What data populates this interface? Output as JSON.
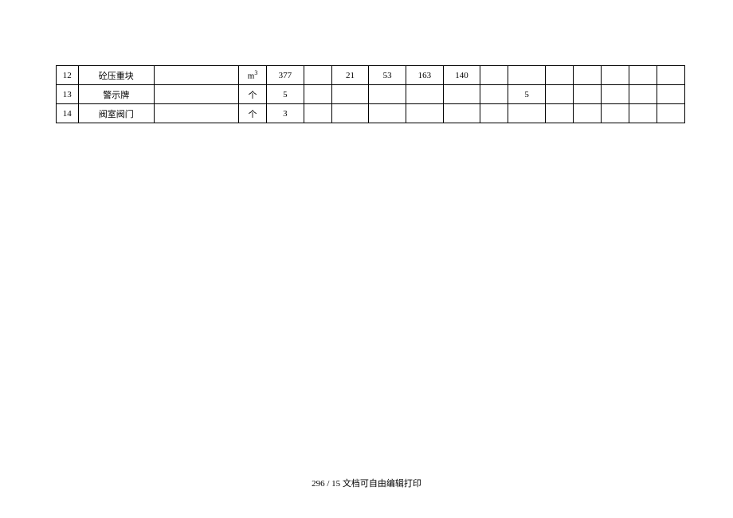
{
  "table": {
    "rows": [
      {
        "c1": "12",
        "c2": "砼压重块",
        "c3": "",
        "c4": "m³",
        "c5": "377",
        "c6": "",
        "c7": "21",
        "c8": "53",
        "c9": "163",
        "c10": "140",
        "c11": "",
        "c12": "",
        "c13": "",
        "c14": "",
        "c15": "",
        "c16": "",
        "c17": ""
      },
      {
        "c1": "13",
        "c2": "警示牌",
        "c3": "",
        "c4": "个",
        "c5": "5",
        "c6": "",
        "c7": "",
        "c8": "",
        "c9": "",
        "c10": "",
        "c11": "",
        "c12": "5",
        "c13": "",
        "c14": "",
        "c15": "",
        "c16": "",
        "c17": ""
      },
      {
        "c1": "14",
        "c2": "阀室阀门",
        "c3": "",
        "c4": "个",
        "c5": "3",
        "c6": "",
        "c7": "",
        "c8": "",
        "c9": "",
        "c10": "",
        "c11": "",
        "c12": "",
        "c13": "",
        "c14": "",
        "c15": "",
        "c16": "",
        "c17": ""
      }
    ]
  },
  "footer": "296 / 15 文档可自由编辑打印"
}
